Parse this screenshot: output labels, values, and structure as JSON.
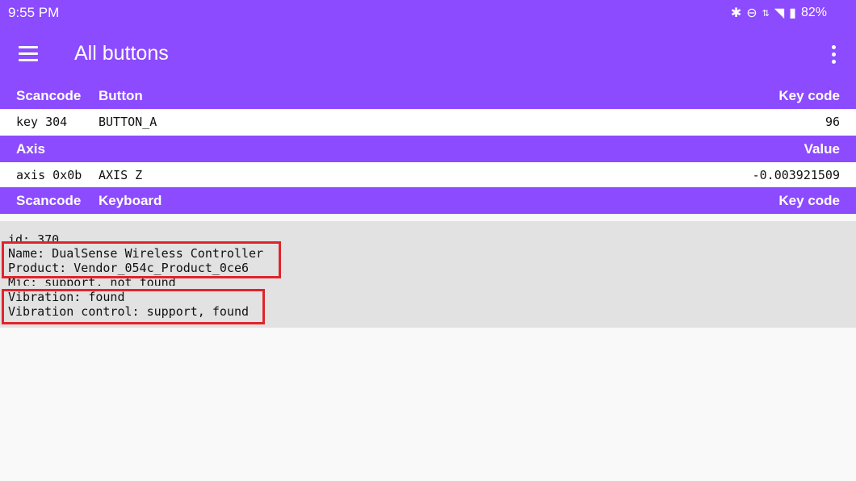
{
  "status_bar": {
    "time": "9:55 PM",
    "battery": "82%"
  },
  "toolbar": {
    "title": "All buttons"
  },
  "buttons_header": {
    "scancode": "Scancode",
    "button": "Button",
    "key_code": "Key code"
  },
  "buttons_row": {
    "scancode": "key 304",
    "button": "BUTTON_A",
    "key_code": "96"
  },
  "axis_header": {
    "axis": "Axis",
    "value": "Value"
  },
  "axis_row": {
    "axis": "axis 0x0b",
    "name": "AXIS Z",
    "value": "-0.003921509"
  },
  "keyboard_header": {
    "scancode": "Scancode",
    "keyboard": "Keyboard",
    "key_code": "Key code"
  },
  "info": {
    "id": "id: 370",
    "name": "Name: DualSense Wireless Controller",
    "product": "Product: Vendor_054c_Product_0ce6",
    "mic": "Mic: support, not found",
    "vibration": "Vibration: found",
    "vibration_control": "Vibration control: support, found"
  },
  "colors": {
    "primary": "#8c4bff",
    "highlight": "#e0242c",
    "info_bg": "#e2e2e2"
  }
}
